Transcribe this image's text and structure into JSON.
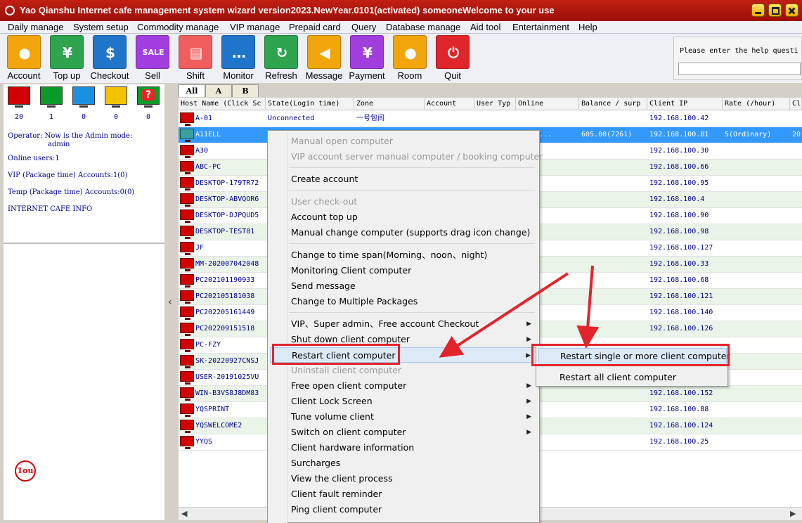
{
  "window": {
    "title": "Yao Qianshu Internet cafe management system wizard version2023.NewYear.0101(activated)  someoneWelcome to your use"
  },
  "menubar": [
    "Daily manage",
    "System setup",
    "Commodity manage",
    "VIP manage",
    "Prepaid card",
    "Query",
    "Database manage",
    "Aid tool",
    "Entertainment",
    "Help"
  ],
  "toolbar": [
    {
      "label": "Account",
      "icon": "user-icon",
      "color": "#f2a60c"
    },
    {
      "label": "Top up",
      "icon": "money-bag-icon",
      "color": "#2ea44f"
    },
    {
      "label": "Checkout",
      "icon": "dollar-icon",
      "color": "#1f75c9"
    },
    {
      "label": "Sell",
      "icon": "sale-tag-icon",
      "color": "#a23ee0"
    },
    {
      "label": "Shift",
      "icon": "cashier-icon",
      "color": "#ef5d5d"
    },
    {
      "label": "Monitor",
      "icon": "chat-icon",
      "color": "#1f75c9"
    },
    {
      "label": "Refresh",
      "icon": "refresh-icon",
      "color": "#2ea44f"
    },
    {
      "label": "Message",
      "icon": "megaphone-icon",
      "color": "#f2a60c"
    },
    {
      "label": "Payment",
      "icon": "yen-icon",
      "color": "#a23ee0"
    },
    {
      "label": "Room",
      "icon": "user-icon",
      "color": "#f2a60c"
    },
    {
      "label": "Quit",
      "icon": "power-icon",
      "color": "#e0262a"
    }
  ],
  "help": {
    "label": "Please enter the help questi",
    "value": ""
  },
  "status_counts": [
    {
      "color": "#d20000",
      "count": "20"
    },
    {
      "color": "#0a9a2a",
      "count": "1"
    },
    {
      "color": "#1b8fe0",
      "count": "0"
    },
    {
      "color": "#f3c300",
      "count": "0"
    },
    {
      "color": "#0a9a2a",
      "count": "0",
      "icon": "question-icon"
    }
  ],
  "info": {
    "operator_line1": "Operator: Now is the Admin mode:",
    "operator_line2": "admin",
    "online_users": "Online users:1",
    "vip_accounts": "VIP (Package time) Accounts:1(0)",
    "temp_accounts": "Temp (Package time) Accounts:0(0)",
    "cafe_info": "INTERNET CAFE  INFO"
  },
  "badge": "1ou",
  "tabs": [
    "All",
    "A",
    "B"
  ],
  "table": {
    "columns": [
      "Host Name (Click Sc",
      "State(Login time)",
      "Zone",
      "Account",
      "User Typ",
      "Online",
      "Balance / surp",
      "Client IP",
      "Rate (/hour)",
      "Cl"
    ],
    "rows": [
      {
        "host": "A-01",
        "state": "Unconnected",
        "zone": "一号包间",
        "account": "",
        "usertype": "",
        "online": "",
        "balance": "",
        "ip": "192.168.100.42",
        "rate": "",
        "cl": ""
      },
      {
        "host": "A11ELL",
        "state": "",
        "zone": "",
        "account": "",
        "usertype": "",
        "online": "r 33 ...",
        "balance": "605.00(7261)",
        "ip": "192.168.100.81",
        "rate": "5(Ordinary)",
        "cl": "20"
      },
      {
        "host": "A30",
        "ip": "192.168.100.30"
      },
      {
        "host": "ABC-PC",
        "ip": "192.168.100.66"
      },
      {
        "host": "DESKTOP-179TR72",
        "ip": "192.168.100.95"
      },
      {
        "host": "DESKTOP-ABVQOR6",
        "ip": "192.168.100.4"
      },
      {
        "host": "DESKTOP-DJPQUD5",
        "ip": "192.168.100.90"
      },
      {
        "host": "DESKTOP-TEST01",
        "ip": "192.168.100.98"
      },
      {
        "host": "JF",
        "ip": "192.168.100.127"
      },
      {
        "host": "MM-202007042048",
        "ip": "192.168.100.33"
      },
      {
        "host": "PC202101190933",
        "ip": "192.168.100.68"
      },
      {
        "host": "PC202105181038",
        "ip": "192.168.100.121"
      },
      {
        "host": "PC202205161449",
        "ip": "192.168.100.140"
      },
      {
        "host": "PC202209151518",
        "ip": "192.168.100.126"
      },
      {
        "host": "PC-FZY",
        "ip": ""
      },
      {
        "host": "SK-20220927CNSJ",
        "ip": ""
      },
      {
        "host": "USER-20191025VU",
        "ip": ""
      },
      {
        "host": "WIN-B3VS8J8DM83",
        "ip": "192.168.100.152"
      },
      {
        "host": "YQSPRINT",
        "ip": "192.168.100.88"
      },
      {
        "host": "YQSWELCOME2",
        "ip": "192.168.100.124"
      },
      {
        "host": "YYQS",
        "ip": "192.168.100.25"
      }
    ]
  },
  "context_menu": [
    {
      "label": "Manual open computer",
      "disabled": true
    },
    {
      "label": "VIP account server manual computer / booking computer",
      "disabled": true
    },
    {
      "sep": true
    },
    {
      "label": "Create account"
    },
    {
      "sep": true
    },
    {
      "label": "User check-out",
      "disabled": true
    },
    {
      "label": "Account top up"
    },
    {
      "label": "Manual change computer (supports drag icon change)"
    },
    {
      "sep": true
    },
    {
      "label": "Change to time span(Morning、noon、night)"
    },
    {
      "label": "Monitoring Client computer"
    },
    {
      "label": "Send message"
    },
    {
      "label": "Change to Multiple Packages"
    },
    {
      "sep": true
    },
    {
      "label": "VIP、Super admin、Free account Checkout",
      "submenu": true
    },
    {
      "label": "Shut down client computer",
      "submenu": true
    },
    {
      "label": "Restart client computer",
      "submenu": true,
      "highlight": true
    },
    {
      "label": "Uninstall client computer",
      "disabled": true
    },
    {
      "label": "Free open client computer",
      "submenu": true
    },
    {
      "label": "Client Lock Screen",
      "submenu": true
    },
    {
      "label": "Tune  volume client",
      "submenu": true
    },
    {
      "label": "Switch on client computer",
      "submenu": true
    },
    {
      "label": "Client hardware information"
    },
    {
      "label": "Surcharges"
    },
    {
      "label": "View the client process"
    },
    {
      "label": "Client fault reminder"
    },
    {
      "label": "Ping client computer"
    }
  ],
  "submenu": [
    {
      "label": "Restart single or more client computer",
      "highlight": true
    },
    {
      "label": "Restart all client computer"
    }
  ],
  "accent": {
    "annotation": "#e3242b",
    "selection": "#3399ff"
  }
}
